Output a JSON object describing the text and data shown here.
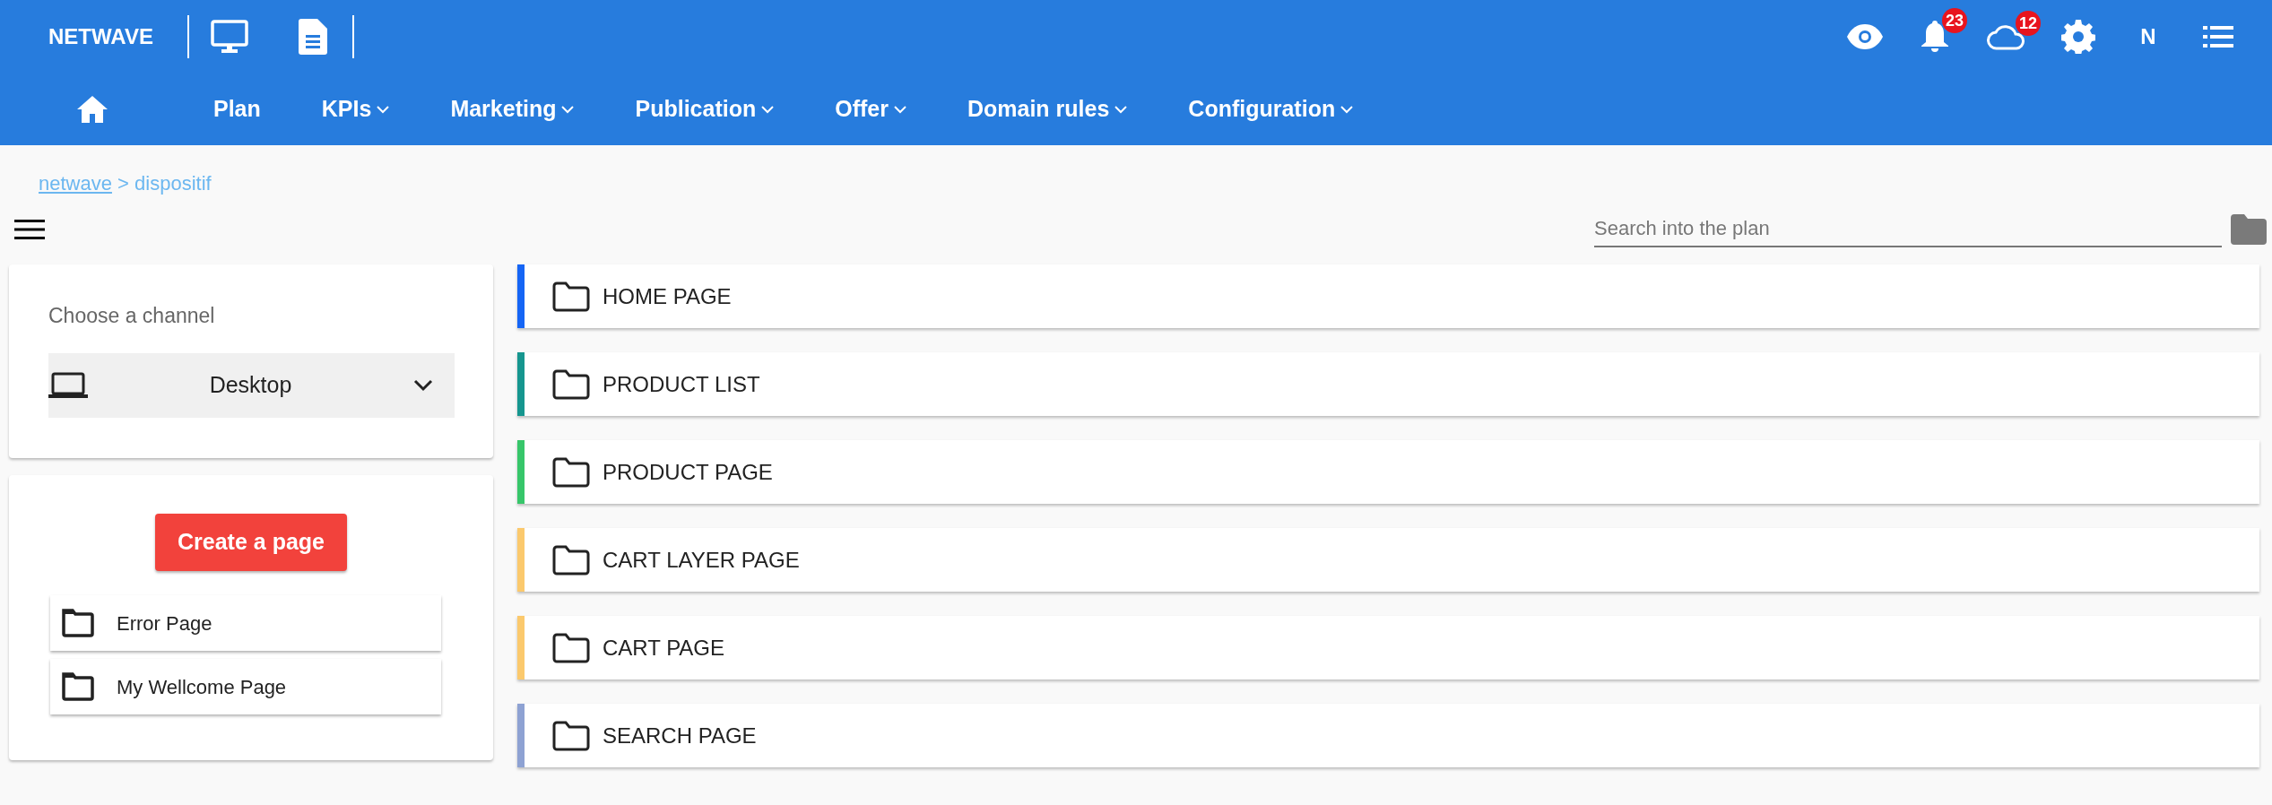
{
  "app_title": "NETWAVE",
  "nav": [
    {
      "kind": "home"
    },
    {
      "kind": "link",
      "label": "Plan"
    },
    {
      "kind": "menu",
      "label": "KPIs"
    },
    {
      "kind": "menu",
      "label": "Marketing"
    },
    {
      "kind": "menu",
      "label": "Publication"
    },
    {
      "kind": "menu",
      "label": "Offer"
    },
    {
      "kind": "menu",
      "label": "Domain rules"
    },
    {
      "kind": "menu",
      "label": "Configuration"
    }
  ],
  "header_actions": [
    {
      "kind": "eye"
    },
    {
      "kind": "bell",
      "badge": "23"
    },
    {
      "kind": "cloud",
      "badge": "12"
    },
    {
      "kind": "gear"
    },
    {
      "kind": "avatar",
      "label": "N"
    },
    {
      "kind": "list"
    }
  ],
  "breadcrumb": {
    "link": "netwave",
    "separator": ">",
    "current": "dispositif"
  },
  "search": {
    "placeholder": "Search into the plan"
  },
  "channel": {
    "label": "Choose a channel",
    "value": "Desktop"
  },
  "create_button": "Create a page",
  "pages": [
    "Error Page",
    "My Wellcome Page"
  ],
  "sections": [
    {
      "label": "HOME PAGE",
      "color": "#1565f5"
    },
    {
      "label": "PRODUCT LIST",
      "color": "#16968f"
    },
    {
      "label": "PRODUCT PAGE",
      "color": "#37c66a"
    },
    {
      "label": "CART LAYER PAGE",
      "color": "#fbc96d"
    },
    {
      "label": "CART PAGE",
      "color": "#fbc96d"
    },
    {
      "label": "SEARCH PAGE",
      "color": "#8ea2d3"
    }
  ]
}
